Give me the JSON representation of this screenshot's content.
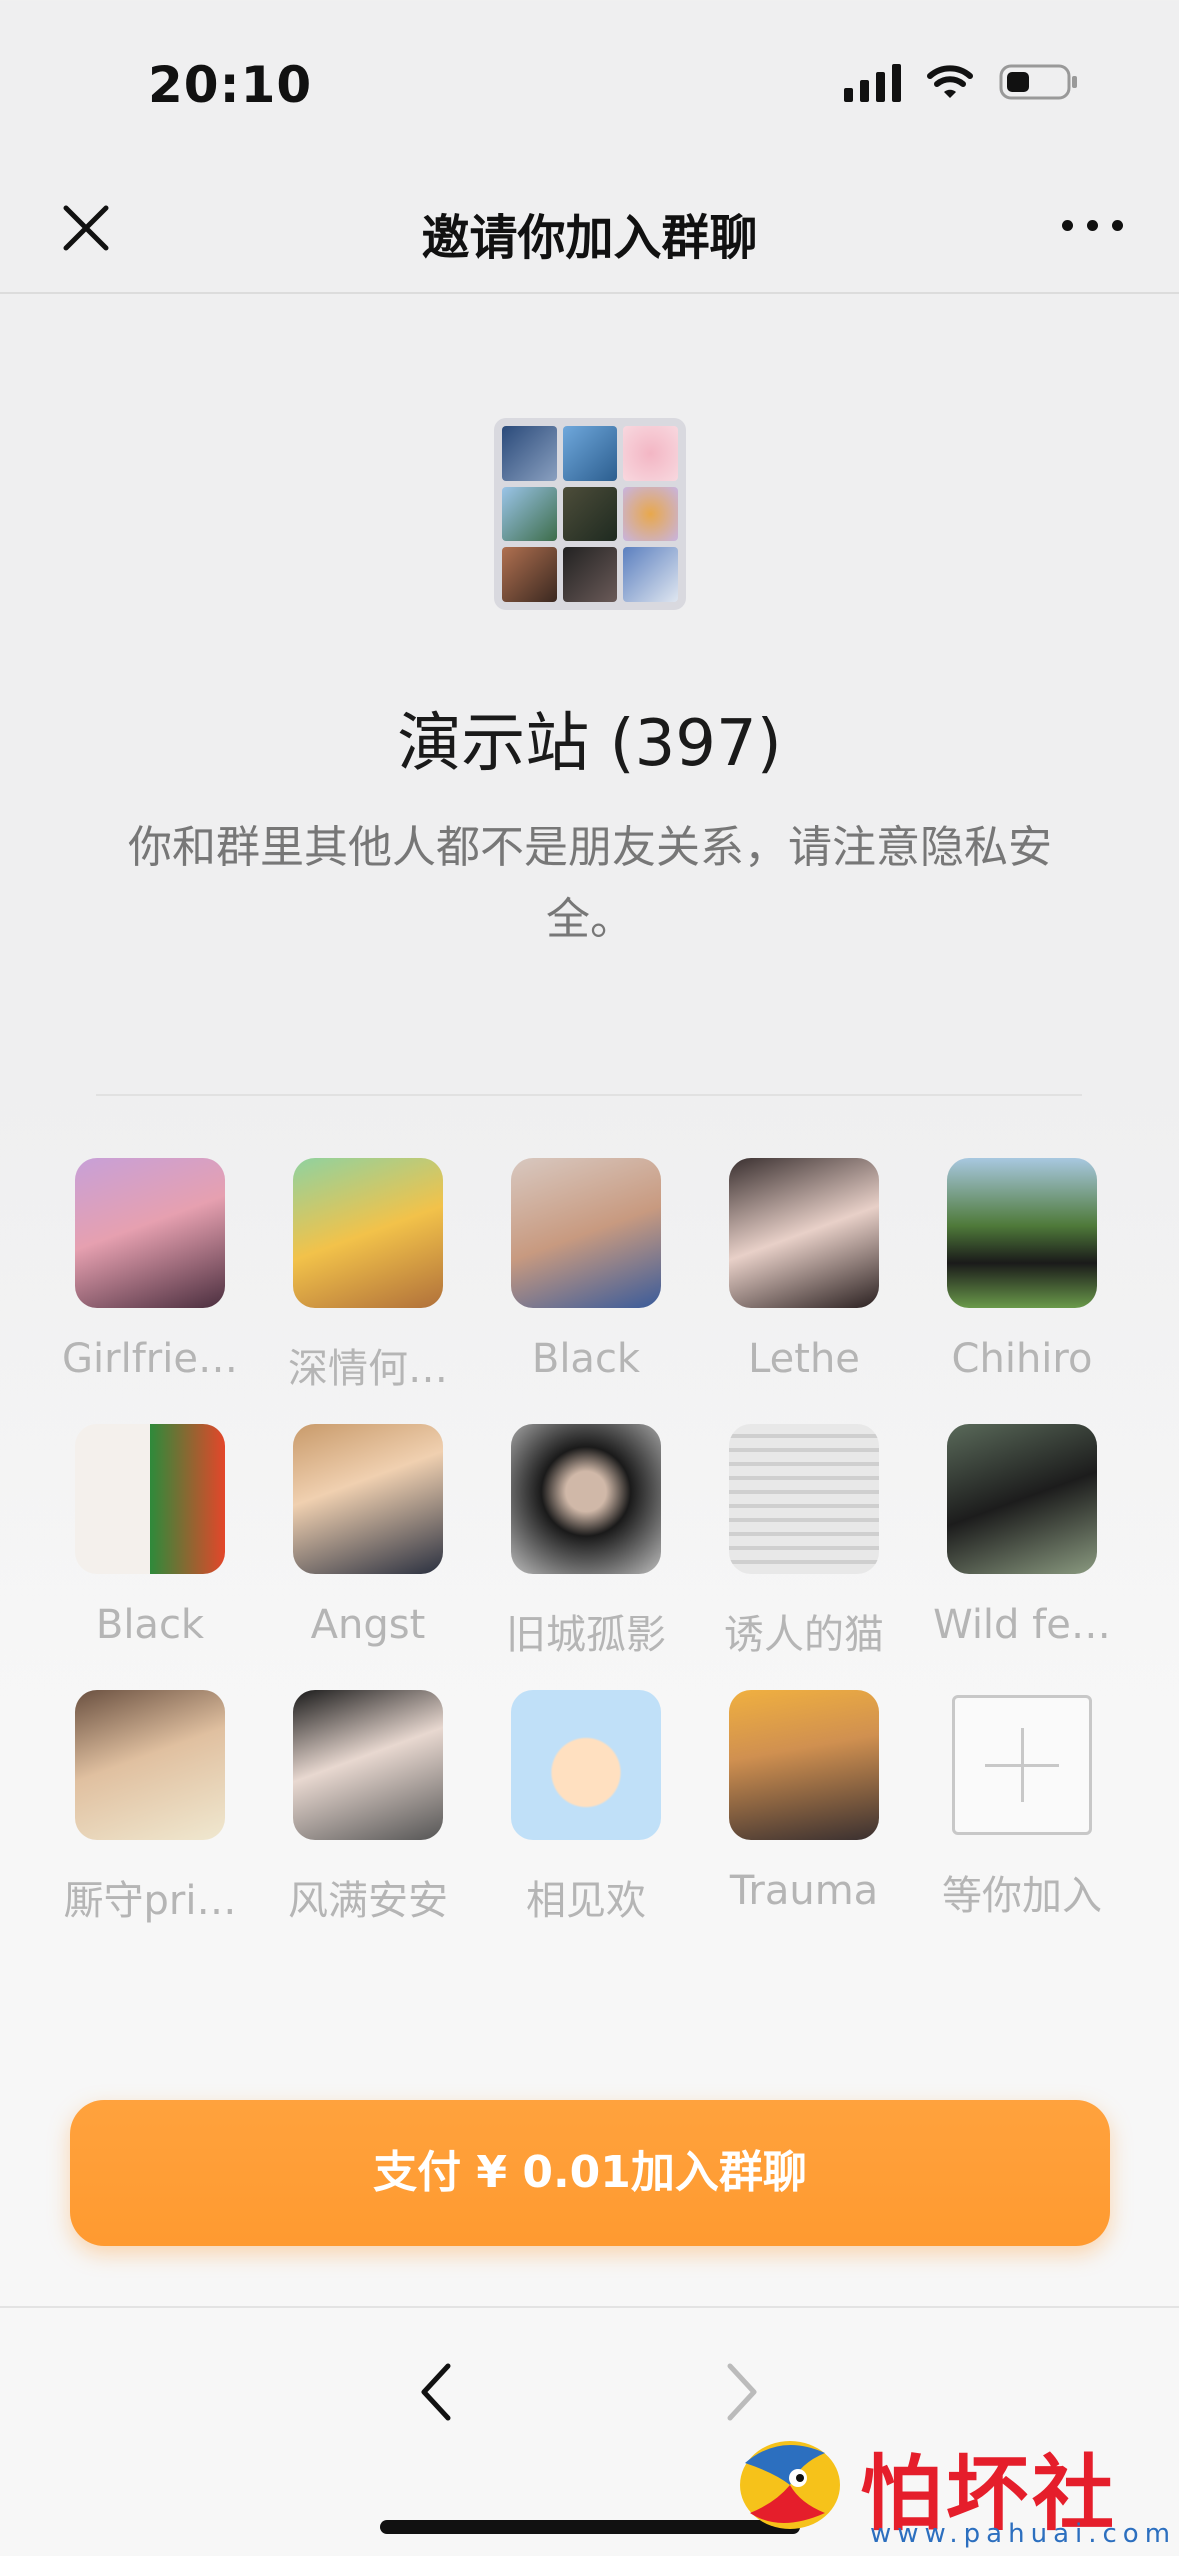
{
  "status_bar": {
    "time": "20:10"
  },
  "nav": {
    "title": "邀请你加入群聊"
  },
  "group": {
    "name": "演示站 (397)",
    "privacy_note": "你和群里其他人都不是朋友关系，请注意隐私安全。"
  },
  "members": [
    {
      "name": "Girlfrie…"
    },
    {
      "name": "深情何…"
    },
    {
      "name": "Black"
    },
    {
      "name": "Lethe"
    },
    {
      "name": "Chihiro"
    },
    {
      "name": "Black"
    },
    {
      "name": "Angst"
    },
    {
      "name": "旧城孤影"
    },
    {
      "name": "诱人的猫"
    },
    {
      "name": "Wild fe…"
    },
    {
      "name": "厮守pri…"
    },
    {
      "name": "风满安安"
    },
    {
      "name": "相见欢"
    },
    {
      "name": "Trauma"
    }
  ],
  "join_slot": {
    "label": "等你加入"
  },
  "pay_button": {
    "label": "支付 ¥ 0.01加入群聊"
  },
  "watermark": {
    "title": "怕坏社区",
    "url": "www.pahuai.com"
  },
  "colors": {
    "accent": "#ff9f3a",
    "muted_text": "#b5b5b5",
    "watermark_red": "#e51e2b"
  },
  "icons": [
    "close-icon",
    "more-icon",
    "back-icon",
    "forward-icon",
    "signal-icon",
    "wifi-icon",
    "battery-icon",
    "plus-icon"
  ]
}
